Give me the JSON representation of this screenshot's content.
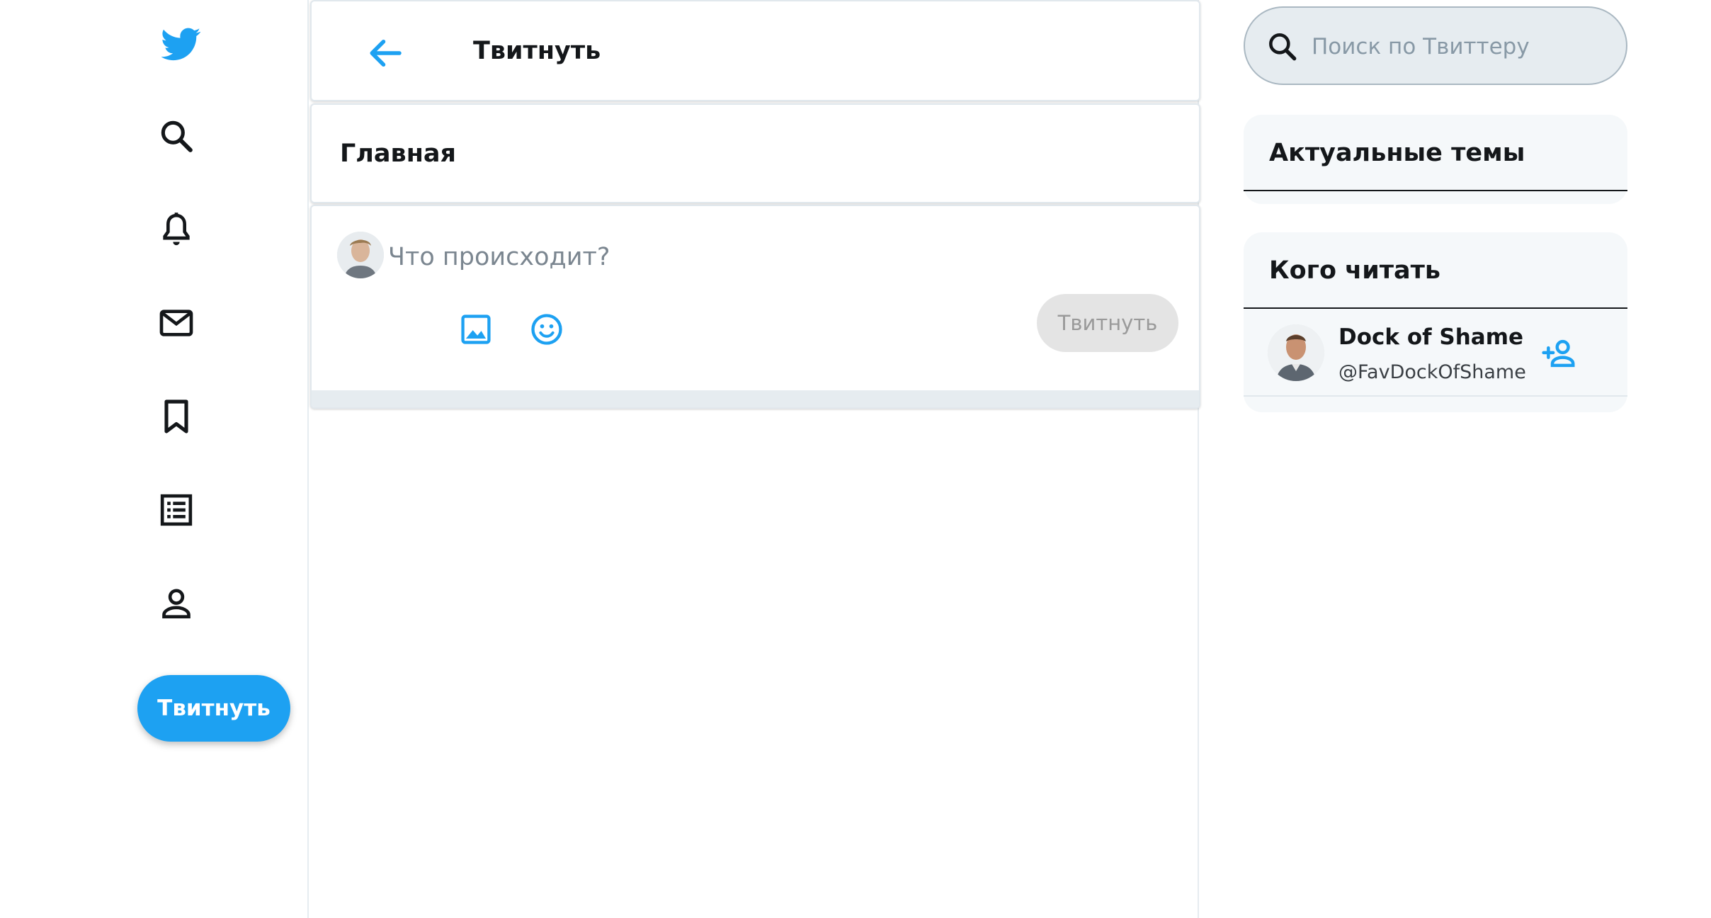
{
  "nav": {
    "icons": [
      "twitter-bird-icon",
      "search-icon",
      "bell-icon",
      "mail-icon",
      "bookmark-icon",
      "list-icon",
      "person-icon"
    ],
    "tweet_label": "Твитнуть"
  },
  "header": {
    "title": "Твитнуть",
    "back_icon": "arrow-left-icon"
  },
  "home": {
    "title": "Главная"
  },
  "compose": {
    "placeholder": "Что происходит?",
    "submit_label": "Твитнуть",
    "tools": [
      "image-icon",
      "emoji-icon"
    ]
  },
  "search": {
    "placeholder": "Поиск по Твиттеру"
  },
  "trends": {
    "title": "Актуальные темы"
  },
  "who_to_follow": {
    "title": "Кого читать",
    "users": [
      {
        "name": "Dock of Shame",
        "handle": "@FavDockOfShame"
      }
    ]
  },
  "colors": {
    "accent": "#1da1f2",
    "text": "#14171a",
    "panel_bg": "#f5f8fa",
    "border": "#e6ecf0"
  }
}
